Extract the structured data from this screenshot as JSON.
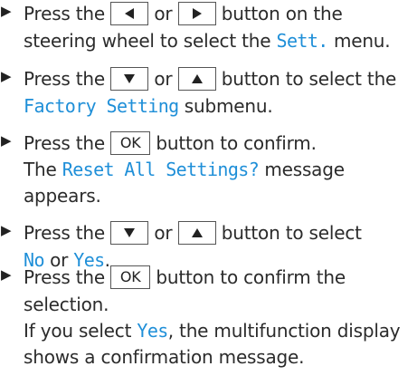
{
  "colors": {
    "highlight": "#1f8fd8",
    "text": "#2b2b2b"
  },
  "bullet": "▶",
  "icons": {
    "left": "left-arrow-button-icon",
    "right": "right-arrow-button-icon",
    "down": "down-arrow-button-icon",
    "up": "up-arrow-button-icon"
  },
  "steps": [
    {
      "l1_a": "Press the",
      "l1_or": "or",
      "l1_b": "button on the",
      "l2_a": "steering wheel to select the",
      "l2_hl": "Sett.",
      "l2_b": "menu."
    },
    {
      "l1_a": "Press the",
      "l1_or": "or",
      "l1_b": "button to select the",
      "l2_hl": "Factory Setting",
      "l2_b": "submenu."
    },
    {
      "l1_a": "Press the",
      "l1_key": "OK",
      "l1_b": "button to confirm.",
      "l2_a": "The",
      "l2_hl": "Reset All Settings?",
      "l2_b": "message",
      "l3": "appears."
    },
    {
      "l1_a": "Press the",
      "l1_or": "or",
      "l1_b": "button to select",
      "l2_hl1": "No",
      "l2_or": "or",
      "l2_hl2": "Yes",
      "l2_end": "."
    },
    {
      "l1_a": "Press the",
      "l1_key": "OK",
      "l1_b": "button to confirm the",
      "l2": "selection.",
      "l3_a": "If you select",
      "l3_hl": "Yes",
      "l3_b": ", the multifunction display",
      "l4": "shows a confirmation message."
    }
  ]
}
